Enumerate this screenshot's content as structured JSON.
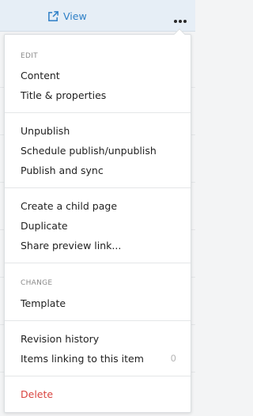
{
  "toolbar": {
    "view_label": "View",
    "view_icon": "external-link-icon",
    "more_icon": "more-dots-icon"
  },
  "colors": {
    "link": "#2d7fc6",
    "danger": "#d9443f",
    "muted": "#8a8a8a"
  },
  "menu": {
    "sections": {
      "edit": "EDIT",
      "change": "CHANGE"
    },
    "items": {
      "content": "Content",
      "title_properties": "Title & properties",
      "unpublish": "Unpublish",
      "schedule": "Schedule publish/unpublish",
      "publish_sync": "Publish and sync",
      "create_child": "Create a child page",
      "duplicate": "Duplicate",
      "share_preview": "Share preview link...",
      "template": "Template",
      "revision_history": "Revision history",
      "items_linking": "Items linking to this item",
      "items_linking_count": "0",
      "delete": "Delete"
    }
  }
}
